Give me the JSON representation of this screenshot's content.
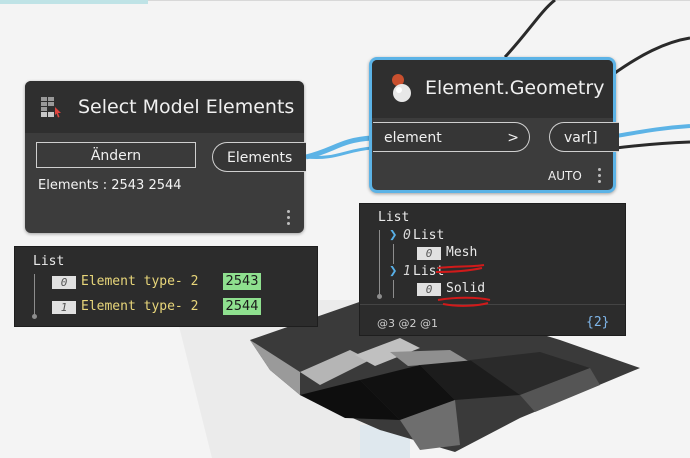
{
  "select_node": {
    "title": "Select Model Elements",
    "change_button": "Ändern",
    "info": "Elements : 2543 2544",
    "output_port": "Elements"
  },
  "geometry_node": {
    "title": "Element.Geometry",
    "input_port": "element",
    "input_chevron": ">",
    "output_port": "var[]",
    "lacing": "AUTO"
  },
  "left_watch": {
    "header": "List",
    "items": [
      {
        "index": "0",
        "label": "Element type- 2",
        "id": "2543"
      },
      {
        "index": "1",
        "label": "Element type- 2",
        "id": "2544"
      }
    ]
  },
  "right_watch": {
    "header": "List",
    "groups": [
      {
        "index": "0",
        "label": "List",
        "child_index": "0",
        "child_value": "Mesh"
      },
      {
        "index": "1",
        "label": "List",
        "child_index": "0",
        "child_value": "Solid"
      }
    ],
    "levels": "@3 @2 @1",
    "count": "{2}"
  },
  "colors": {
    "node_body": "#3c3c3c",
    "node_header": "#2f2f2f",
    "selection_border": "#5cb3e6",
    "wire": "#5cb3e6",
    "id_badge": "#8fe08f",
    "element_text": "#e8d67a",
    "annotation": "#d11a1a"
  },
  "icons": [
    "select-elements-icon",
    "geometry-icon",
    "more-options-icon",
    "expand-chevron-icon"
  ]
}
